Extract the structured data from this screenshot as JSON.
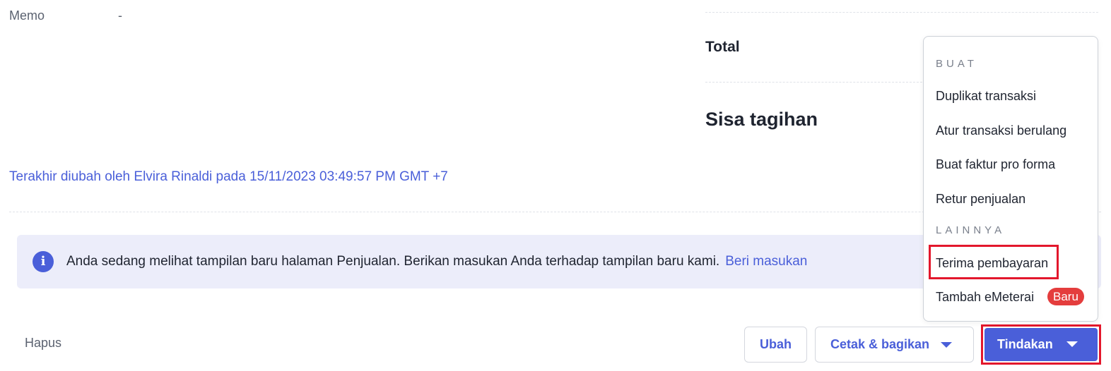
{
  "memo": {
    "label": "Memo",
    "value": "-"
  },
  "summary": {
    "total_label": "Total",
    "sisa_label": "Sisa tagihan"
  },
  "last_modified": "Terakhir diubah oleh Elvira Rinaldi pada 15/11/2023 03:49:57 PM GMT +7",
  "banner": {
    "text": "Anda sedang melihat tampilan baru halaman Penjualan. Berikan masukan Anda terhadap tampilan baru kami.",
    "link": "Beri masukan",
    "icon": "info-icon"
  },
  "footer": {
    "delete_label": "Hapus",
    "edit_label": "Ubah",
    "print_share_label": "Cetak & bagikan",
    "actions_label": "Tindakan"
  },
  "dropdown": {
    "section_create": "BUAT",
    "items_create": [
      "Duplikat transaksi",
      "Atur transaksi berulang",
      "Buat faktur pro forma",
      "Retur penjualan"
    ],
    "section_other": "LAINNYA",
    "items_other": [
      "Terima pembayaran",
      "Tambah eMeterai"
    ],
    "badge_new": "Baru"
  },
  "colors": {
    "accent": "#4a5fd9",
    "highlight": "#e3172c",
    "badge": "#e43d3d",
    "banner_bg": "#ecedfa"
  }
}
